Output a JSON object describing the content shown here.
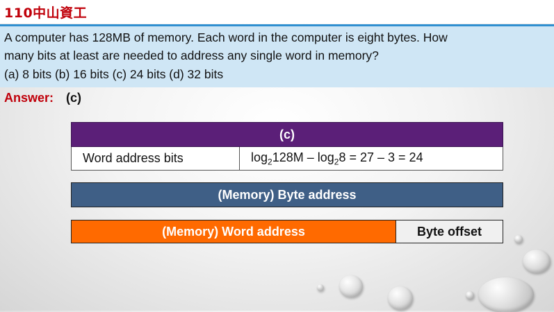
{
  "slide": {
    "title": "110中山資工",
    "question": {
      "line1": "A computer has 128MB of memory. Each word in the computer is eight bytes. How",
      "line2": "many bits at least are needed to address any single word in memory?",
      "line3": "(a) 8 bits (b) 16 bits (c) 24 bits (d) 32 bits"
    },
    "answer": {
      "label": "Answer:",
      "value": "(c)"
    }
  },
  "result_table": {
    "header": "(c)",
    "row_label": "Word address bits",
    "formula": {
      "part1": "log",
      "sub1": "2",
      "part2": "128M – log",
      "sub2": "2",
      "part3": "8 = 27 – 3 = 24"
    }
  },
  "diagram": {
    "byte_address": "(Memory) Byte address",
    "word_address": "(Memory) Word address",
    "byte_offset": "Byte offset"
  },
  "colors": {
    "title_red": "#c0000a",
    "question_bg": "#cfe6f5",
    "table_header": "#5b1f78",
    "byte_address_bar": "#3f5f86",
    "word_address_bar": "#ff6a00"
  }
}
